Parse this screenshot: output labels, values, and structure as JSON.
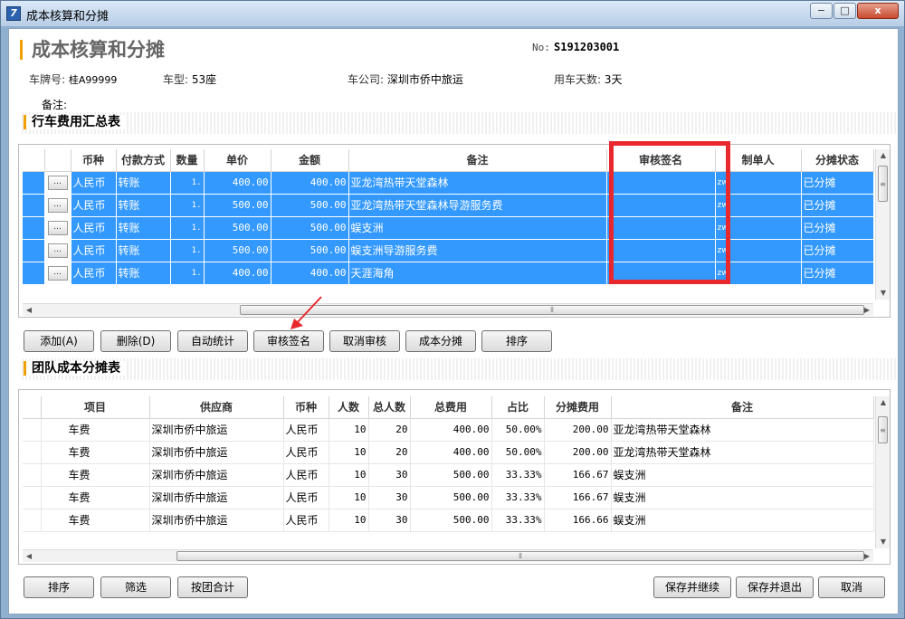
{
  "window": {
    "title": "成本核算和分摊",
    "icon": "app-icon",
    "controls": {
      "minimize": "−",
      "restore": "□",
      "close": "x"
    }
  },
  "header": {
    "title": "成本核算和分摊",
    "no_label": "No:",
    "no_value": "S191203001"
  },
  "info": {
    "plate_label": "车牌号:",
    "plate_value": "桂A99999",
    "type_label": "车型:",
    "type_value": "53座",
    "company_label": "车公司:",
    "company_value": "深圳市侨中旅运",
    "days_label": "用车天数:",
    "days_value": "3天",
    "remark_label": "备注:"
  },
  "section1": {
    "title": "行车费用汇总表",
    "columns": [
      "",
      "",
      "币种",
      "付款方式",
      "数量",
      "单价",
      "金额",
      "备注",
      "审核签名",
      "制单人",
      "分摊状态"
    ],
    "rows": [
      {
        "btn": "...",
        "currency": "人民币",
        "pay": "转账",
        "qty": "1.",
        "price": "400.00",
        "amount": "400.00",
        "remark": "亚龙湾热带天堂森林",
        "sign": "",
        "maker": "zw",
        "status": "已分摊"
      },
      {
        "btn": "...",
        "currency": "人民币",
        "pay": "转账",
        "qty": "1.",
        "price": "500.00",
        "amount": "500.00",
        "remark": "亚龙湾热带天堂森林导游服务费",
        "sign": "",
        "maker": "zw",
        "status": "已分摊"
      },
      {
        "btn": "...",
        "currency": "人民币",
        "pay": "转账",
        "qty": "1.",
        "price": "500.00",
        "amount": "500.00",
        "remark": "蜈支洲",
        "sign": "",
        "maker": "zw",
        "status": "已分摊"
      },
      {
        "btn": "...",
        "currency": "人民币",
        "pay": "转账",
        "qty": "1.",
        "price": "500.00",
        "amount": "500.00",
        "remark": "蜈支洲导游服务费",
        "sign": "",
        "maker": "zw",
        "status": "已分摊"
      },
      {
        "btn": "...",
        "currency": "人民币",
        "pay": "转账",
        "qty": "1.",
        "price": "400.00",
        "amount": "400.00",
        "remark": "天涯海角",
        "sign": "",
        "maker": "zw",
        "status": "已分摊"
      }
    ]
  },
  "toolbar": {
    "add": "添加(A)",
    "delete": "删除(D)",
    "auto_stat": "自动统计",
    "audit_sign": "审核签名",
    "cancel_audit": "取消审核",
    "cost_share": "成本分摊",
    "sort": "排序"
  },
  "section2": {
    "title": "团队成本分摊表",
    "columns": [
      "",
      "项目",
      "供应商",
      "币种",
      "人数",
      "总人数",
      "总费用",
      "占比",
      "分摊费用",
      "备注"
    ],
    "rows": [
      {
        "item": "车费",
        "supplier": "深圳市侨中旅运",
        "currency": "人民币",
        "people": "10",
        "total_people": "20",
        "total_cost": "400.00",
        "ratio": "50.00%",
        "share": "200.00",
        "remark": "亚龙湾热带天堂森林"
      },
      {
        "item": "车费",
        "supplier": "深圳市侨中旅运",
        "currency": "人民币",
        "people": "10",
        "total_people": "20",
        "total_cost": "400.00",
        "ratio": "50.00%",
        "share": "200.00",
        "remark": "亚龙湾热带天堂森林"
      },
      {
        "item": "车费",
        "supplier": "深圳市侨中旅运",
        "currency": "人民币",
        "people": "10",
        "total_people": "30",
        "total_cost": "500.00",
        "ratio": "33.33%",
        "share": "166.67",
        "remark": "蜈支洲"
      },
      {
        "item": "车费",
        "supplier": "深圳市侨中旅运",
        "currency": "人民币",
        "people": "10",
        "total_people": "30",
        "total_cost": "500.00",
        "ratio": "33.33%",
        "share": "166.67",
        "remark": "蜈支洲"
      },
      {
        "item": "车费",
        "supplier": "深圳市侨中旅运",
        "currency": "人民币",
        "people": "10",
        "total_people": "30",
        "total_cost": "500.00",
        "ratio": "33.33%",
        "share": "166.66",
        "remark": "蜈支洲"
      }
    ]
  },
  "footer": {
    "sort": "排序",
    "filter": "筛选",
    "group_total": "按团合计",
    "save_continue": "保存并继续",
    "save_exit": "保存并退出",
    "cancel": "取消"
  },
  "colors": {
    "selection": "#3399ff",
    "accent": "#f0a000",
    "annotation": "#e8282d"
  }
}
